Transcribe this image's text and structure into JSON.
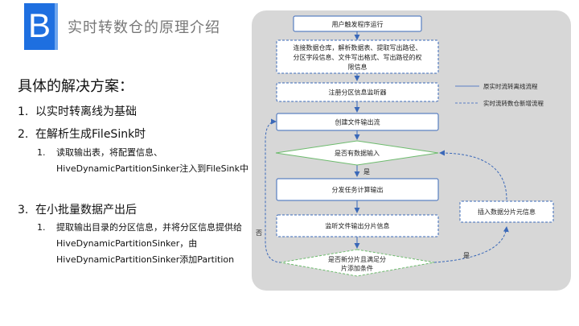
{
  "header": {
    "badge": "B",
    "title": "实时转数仓的原理介绍"
  },
  "left": {
    "heading": "具体的解决方案：",
    "items": [
      {
        "num": "1.",
        "text": "以实时转离线为基础"
      },
      {
        "num": "2.",
        "text": "在解析生成FileSink时",
        "sub": [
          {
            "num": "1.",
            "text": "读取输出表，将配置信息、HiveDynamicPartitionSinker注入到FileSink中"
          }
        ]
      },
      {
        "num": "3.",
        "text": "在小批量数据产出后",
        "sub": [
          {
            "num": "1.",
            "text": "提取输出目录的分区信息，并将分区信息提供给HiveDynamicPartitionSinker，由HiveDynamicPartitionSinker添加Partition"
          }
        ]
      }
    ]
  },
  "flow": {
    "start": "用户触发程序运行",
    "step1": [
      "连接数据仓库，解析数据表、提取写出路径、",
      "分区字段信息、文件写出格式、写出路径的权",
      "限信息"
    ],
    "register": "注册分区信息监听器",
    "create_stream": "创建文件输出流",
    "has_data": "是否有数据输入",
    "yes1": "是",
    "dispatch": "分发任务计算输出",
    "monitor": "监听文件输出分片信息",
    "new_shard": [
      "是否新分片且满足分",
      "片添加条件"
    ],
    "insert_meta": "插入数据分片元信息",
    "yes2": "是",
    "no": "否",
    "legend": {
      "solid": "原实时流转离线流程",
      "dashed": "实时流转数仓新增流程"
    },
    "colors": {
      "box_border": "#3a68b8",
      "diamond_border": "#6dbb6d",
      "panel": "#d7d7d7",
      "accent": "#1e6fe0"
    }
  }
}
